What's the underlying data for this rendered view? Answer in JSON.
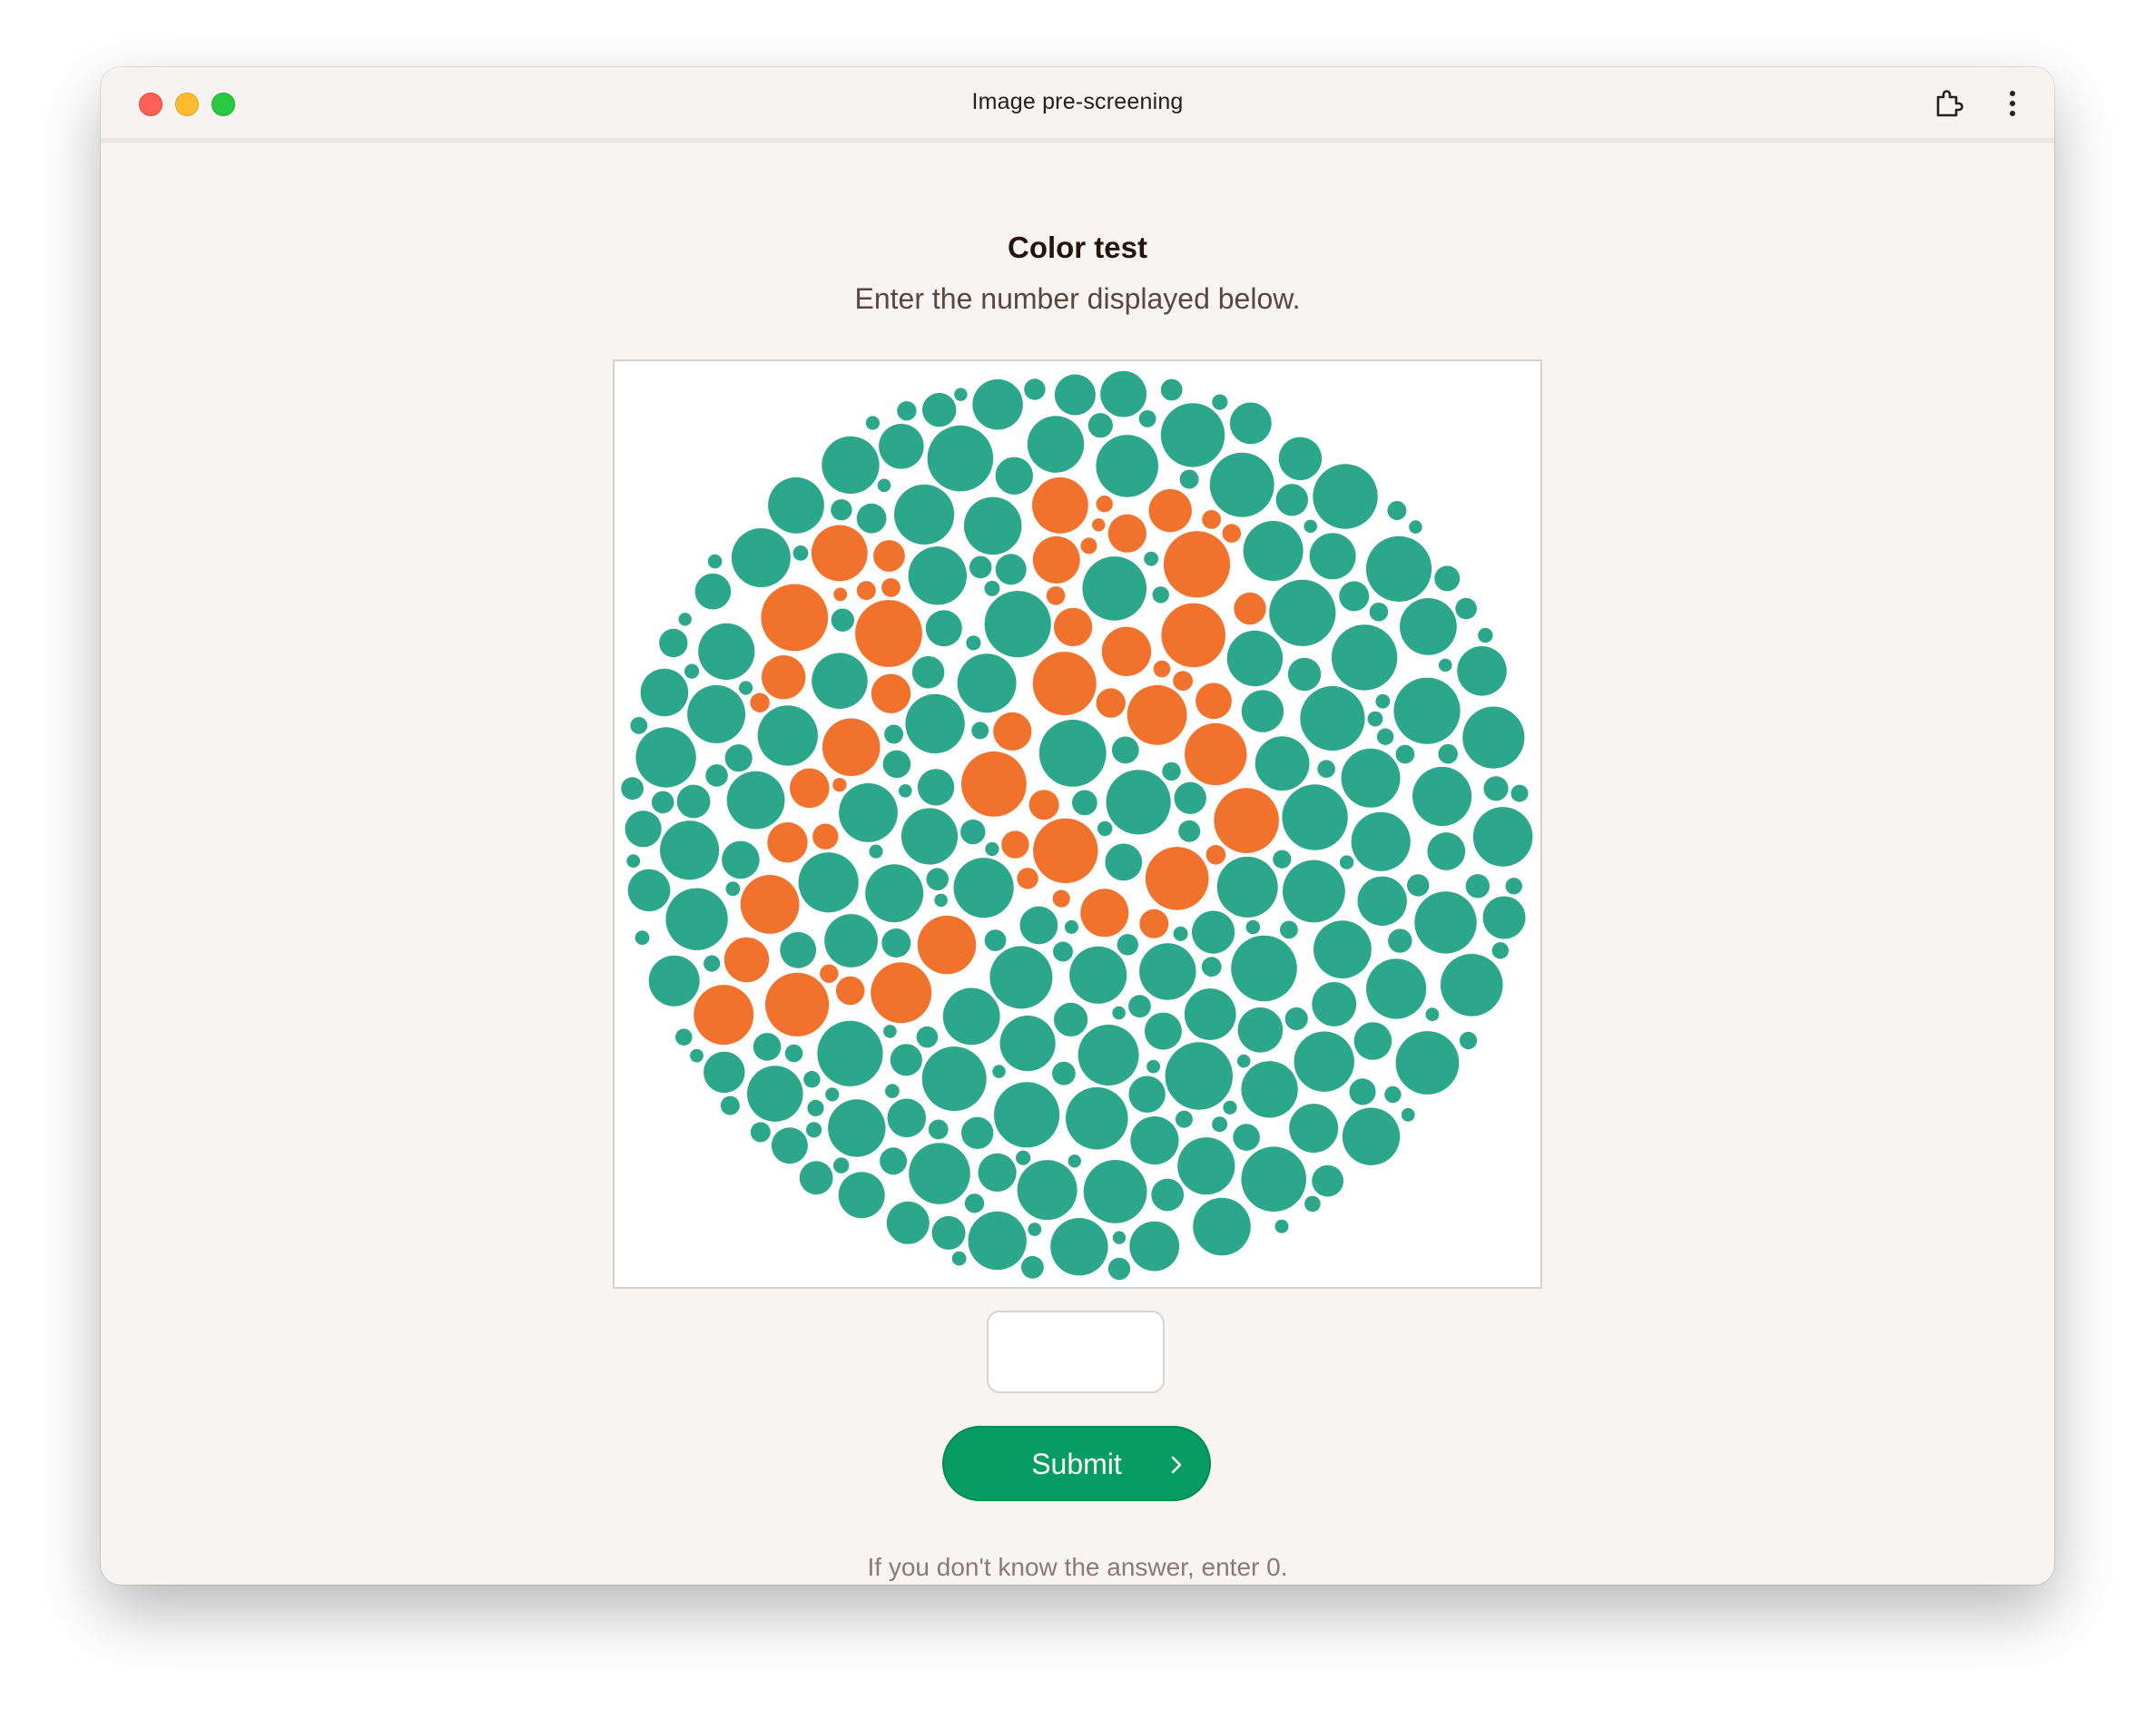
{
  "window": {
    "title": "Image pre-screening"
  },
  "toolbar": {
    "extension_icon": "puzzle-piece-icon",
    "menu_icon": "vertical-ellipsis-icon"
  },
  "test": {
    "heading": "Color test",
    "instruction": "Enter the number displayed below.",
    "plate_image": "color-blindness-dot-plate",
    "plate_number": "28",
    "answer_value": "",
    "answer_placeholder": "",
    "submit_label": "Submit",
    "submit_icon": "chevron-right-icon",
    "hint": "If you don't know the answer, enter 0."
  },
  "colors": {
    "background_dot": "#2ca78c",
    "figure_dot": "#f0722c",
    "submit": "#079c61",
    "window_bg": "#f8f4f1"
  }
}
